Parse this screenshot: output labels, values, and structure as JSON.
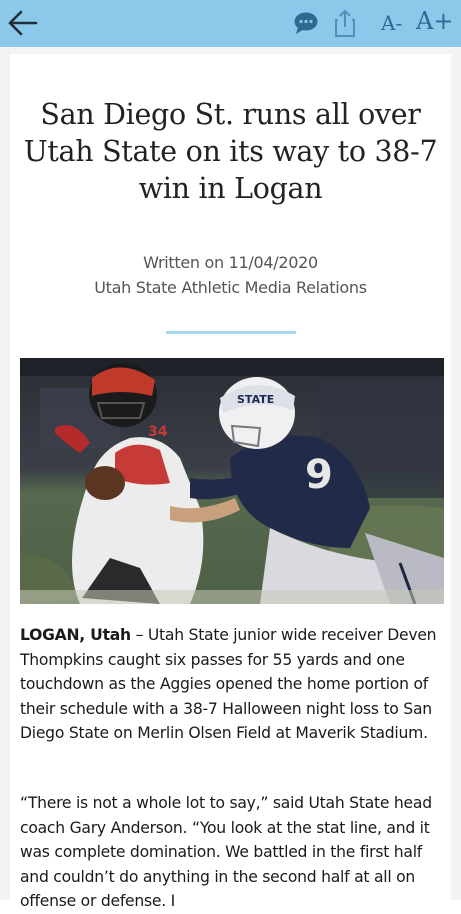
{
  "toolbar": {
    "back_icon": "arrow-left-icon",
    "comment_icon": "speech-bubble-icon",
    "share_icon": "share-icon",
    "font_decrease_label": "A-",
    "font_increase_label": "A+",
    "bar_color": "#8cc8ea",
    "icon_color": "#2b6b91"
  },
  "article": {
    "title": "San Diego St. runs all over Utah State on its way to 38-7 win in Logan",
    "written_on": "Written on 11/04/2020",
    "author": "Utah State Athletic Media Relations",
    "divider_color": "#a8d7f0",
    "photo_alt": "Football game photo: San Diego State running back #34 being tackled by Utah State defender #9",
    "paragraphs": [
      {
        "dateline": "LOGAN, Utah",
        "text": " – Utah State junior wide receiver Deven Thompkins caught six passes for 55 yards and one touchdown as the Aggies opened the home portion of their schedule with a 38-7 Halloween night loss to San Diego State on Merlin Olsen Field at Maverik Stadium."
      },
      {
        "dateline": "",
        "text": "“There is not a whole lot to say,” said Utah State head coach Gary Anderson. “You look at the stat line, and it was complete domination. We battled in the first half and couldn’t do anything in the second half at all on offense or defense. I"
      }
    ]
  }
}
